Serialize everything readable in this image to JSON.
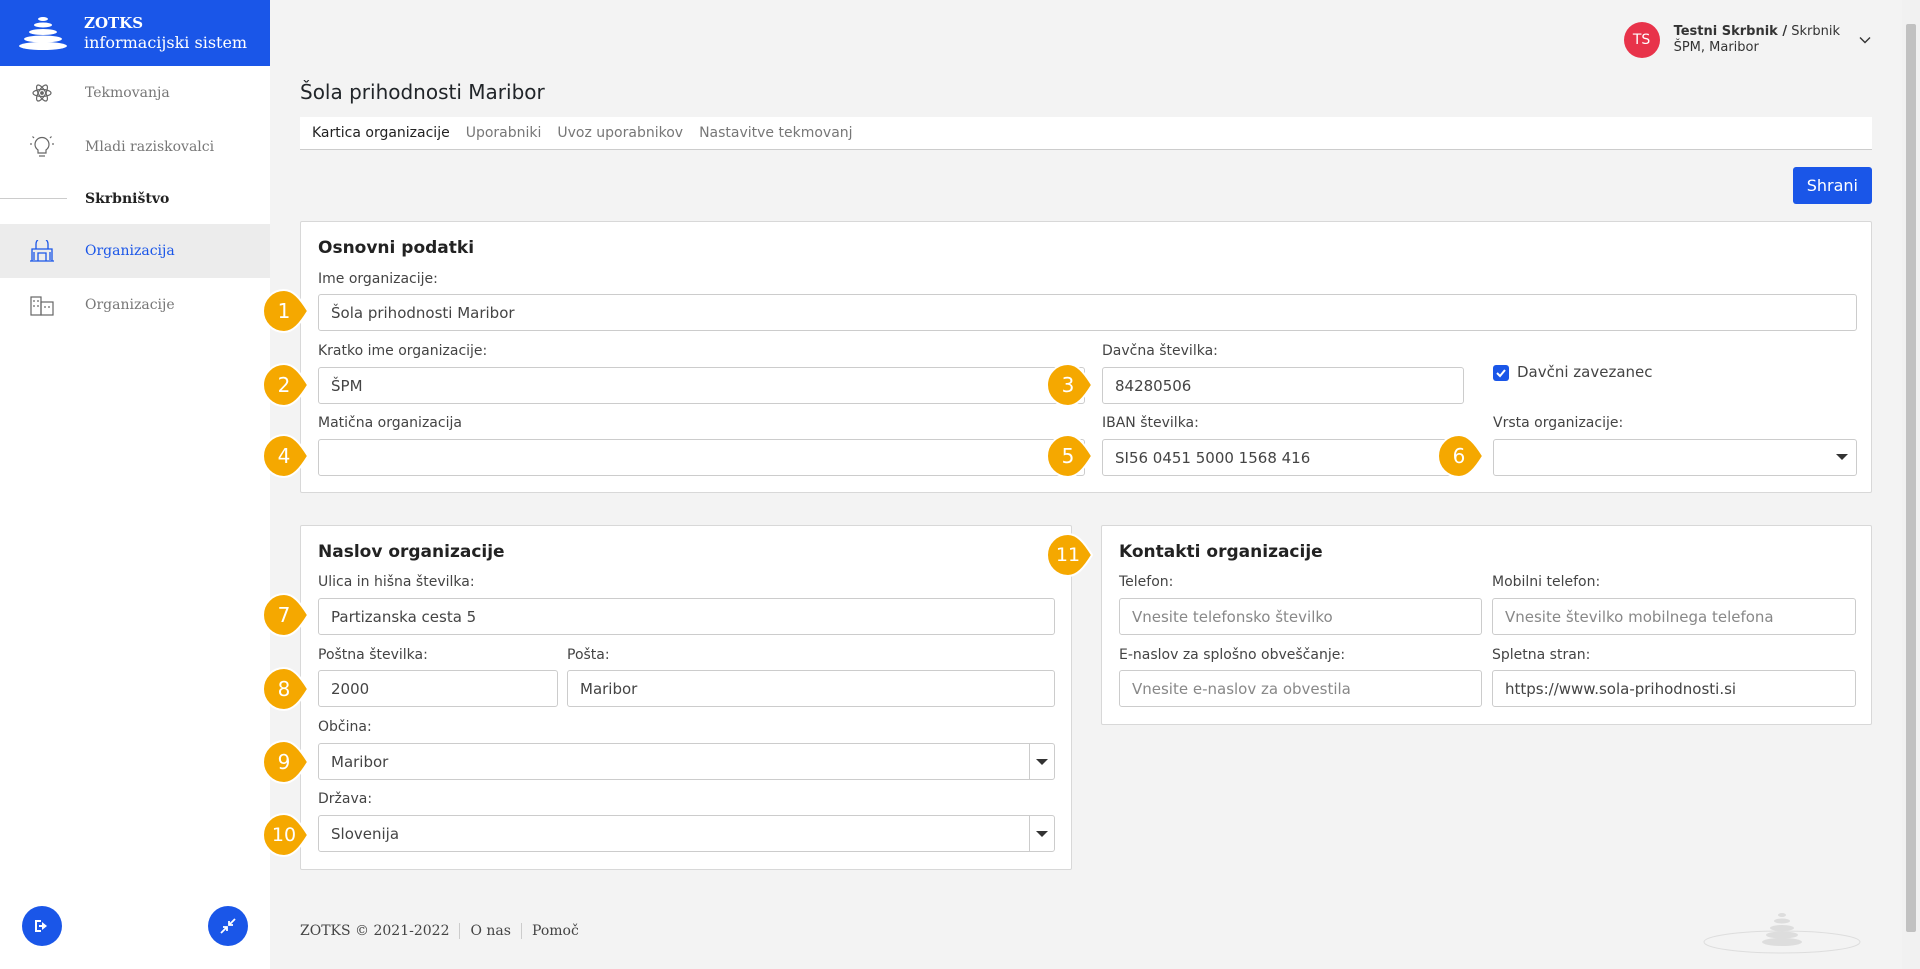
{
  "brand": {
    "line1": "ZOTKS",
    "line2": "informacijski sistem"
  },
  "sidebar": {
    "items": [
      {
        "label": "Tekmovanja",
        "icon": "atom-icon"
      },
      {
        "label": "Mladi raziskovalci",
        "icon": "lightbulb-icon"
      }
    ],
    "section": "Skrbništvo",
    "sub_items": [
      {
        "label": "Organizacija",
        "icon": "institution-icon",
        "active": true
      },
      {
        "label": "Organizacije",
        "icon": "buildings-icon",
        "active": false
      }
    ]
  },
  "user": {
    "initials": "TS",
    "name": "Testni Skrbnik /",
    "role": "Skrbnik",
    "org": "ŠPM, Maribor"
  },
  "page": {
    "title": "Šola prihodnosti Maribor"
  },
  "tabs": [
    "Kartica organizacije",
    "Uporabniki",
    "Uvoz uporabnikov",
    "Nastavitve tekmovanj"
  ],
  "save_label": "Shrani",
  "basic": {
    "title": "Osnovni podatki",
    "name_label": "Ime organizacije:",
    "name_value": "Šola prihodnosti Maribor",
    "short_label": "Kratko ime organizacije:",
    "short_value": "ŠPM",
    "tax_label": "Davčna številka:",
    "tax_value": "84280506",
    "vat_label": "Davčni zavezanec",
    "parent_label": "Matična organizacija",
    "parent_value": "",
    "iban_label": "IBAN številka:",
    "iban_value": "SI56 0451 5000 1568 416",
    "type_label": "Vrsta organizacije:",
    "type_value": ""
  },
  "address": {
    "title": "Naslov organizacije",
    "street_label": "Ulica in hišna številka:",
    "street_value": "Partizanska cesta 5",
    "zip_label": "Poštna številka:",
    "zip_value": "2000",
    "post_label": "Pošta:",
    "post_value": "Maribor",
    "municipality_label": "Občina:",
    "municipality_value": "Maribor",
    "country_label": "Država:",
    "country_value": "Slovenija"
  },
  "contacts": {
    "title": "Kontakti organizacije",
    "phone_label": "Telefon:",
    "phone_placeholder": "Vnesite telefonsko številko",
    "mobile_label": "Mobilni telefon:",
    "mobile_placeholder": "Vnesite številko mobilnega telefona",
    "email_label": "E-naslov za splošno obveščanje:",
    "email_placeholder": "Vnesite e-naslov za obvestila",
    "web_label": "Spletna stran:",
    "web_value": "https://www.sola-prihodnosti.si"
  },
  "callouts": [
    "1",
    "2",
    "3",
    "4",
    "5",
    "6",
    "7",
    "8",
    "9",
    "10",
    "11"
  ],
  "footer": {
    "copyright": "ZOTKS © 2021-2022",
    "about": "O nas",
    "help": "Pomoč"
  },
  "colors": {
    "primary": "#1a56e8",
    "callout": "#f5a800",
    "avatar": "#e8334a"
  }
}
